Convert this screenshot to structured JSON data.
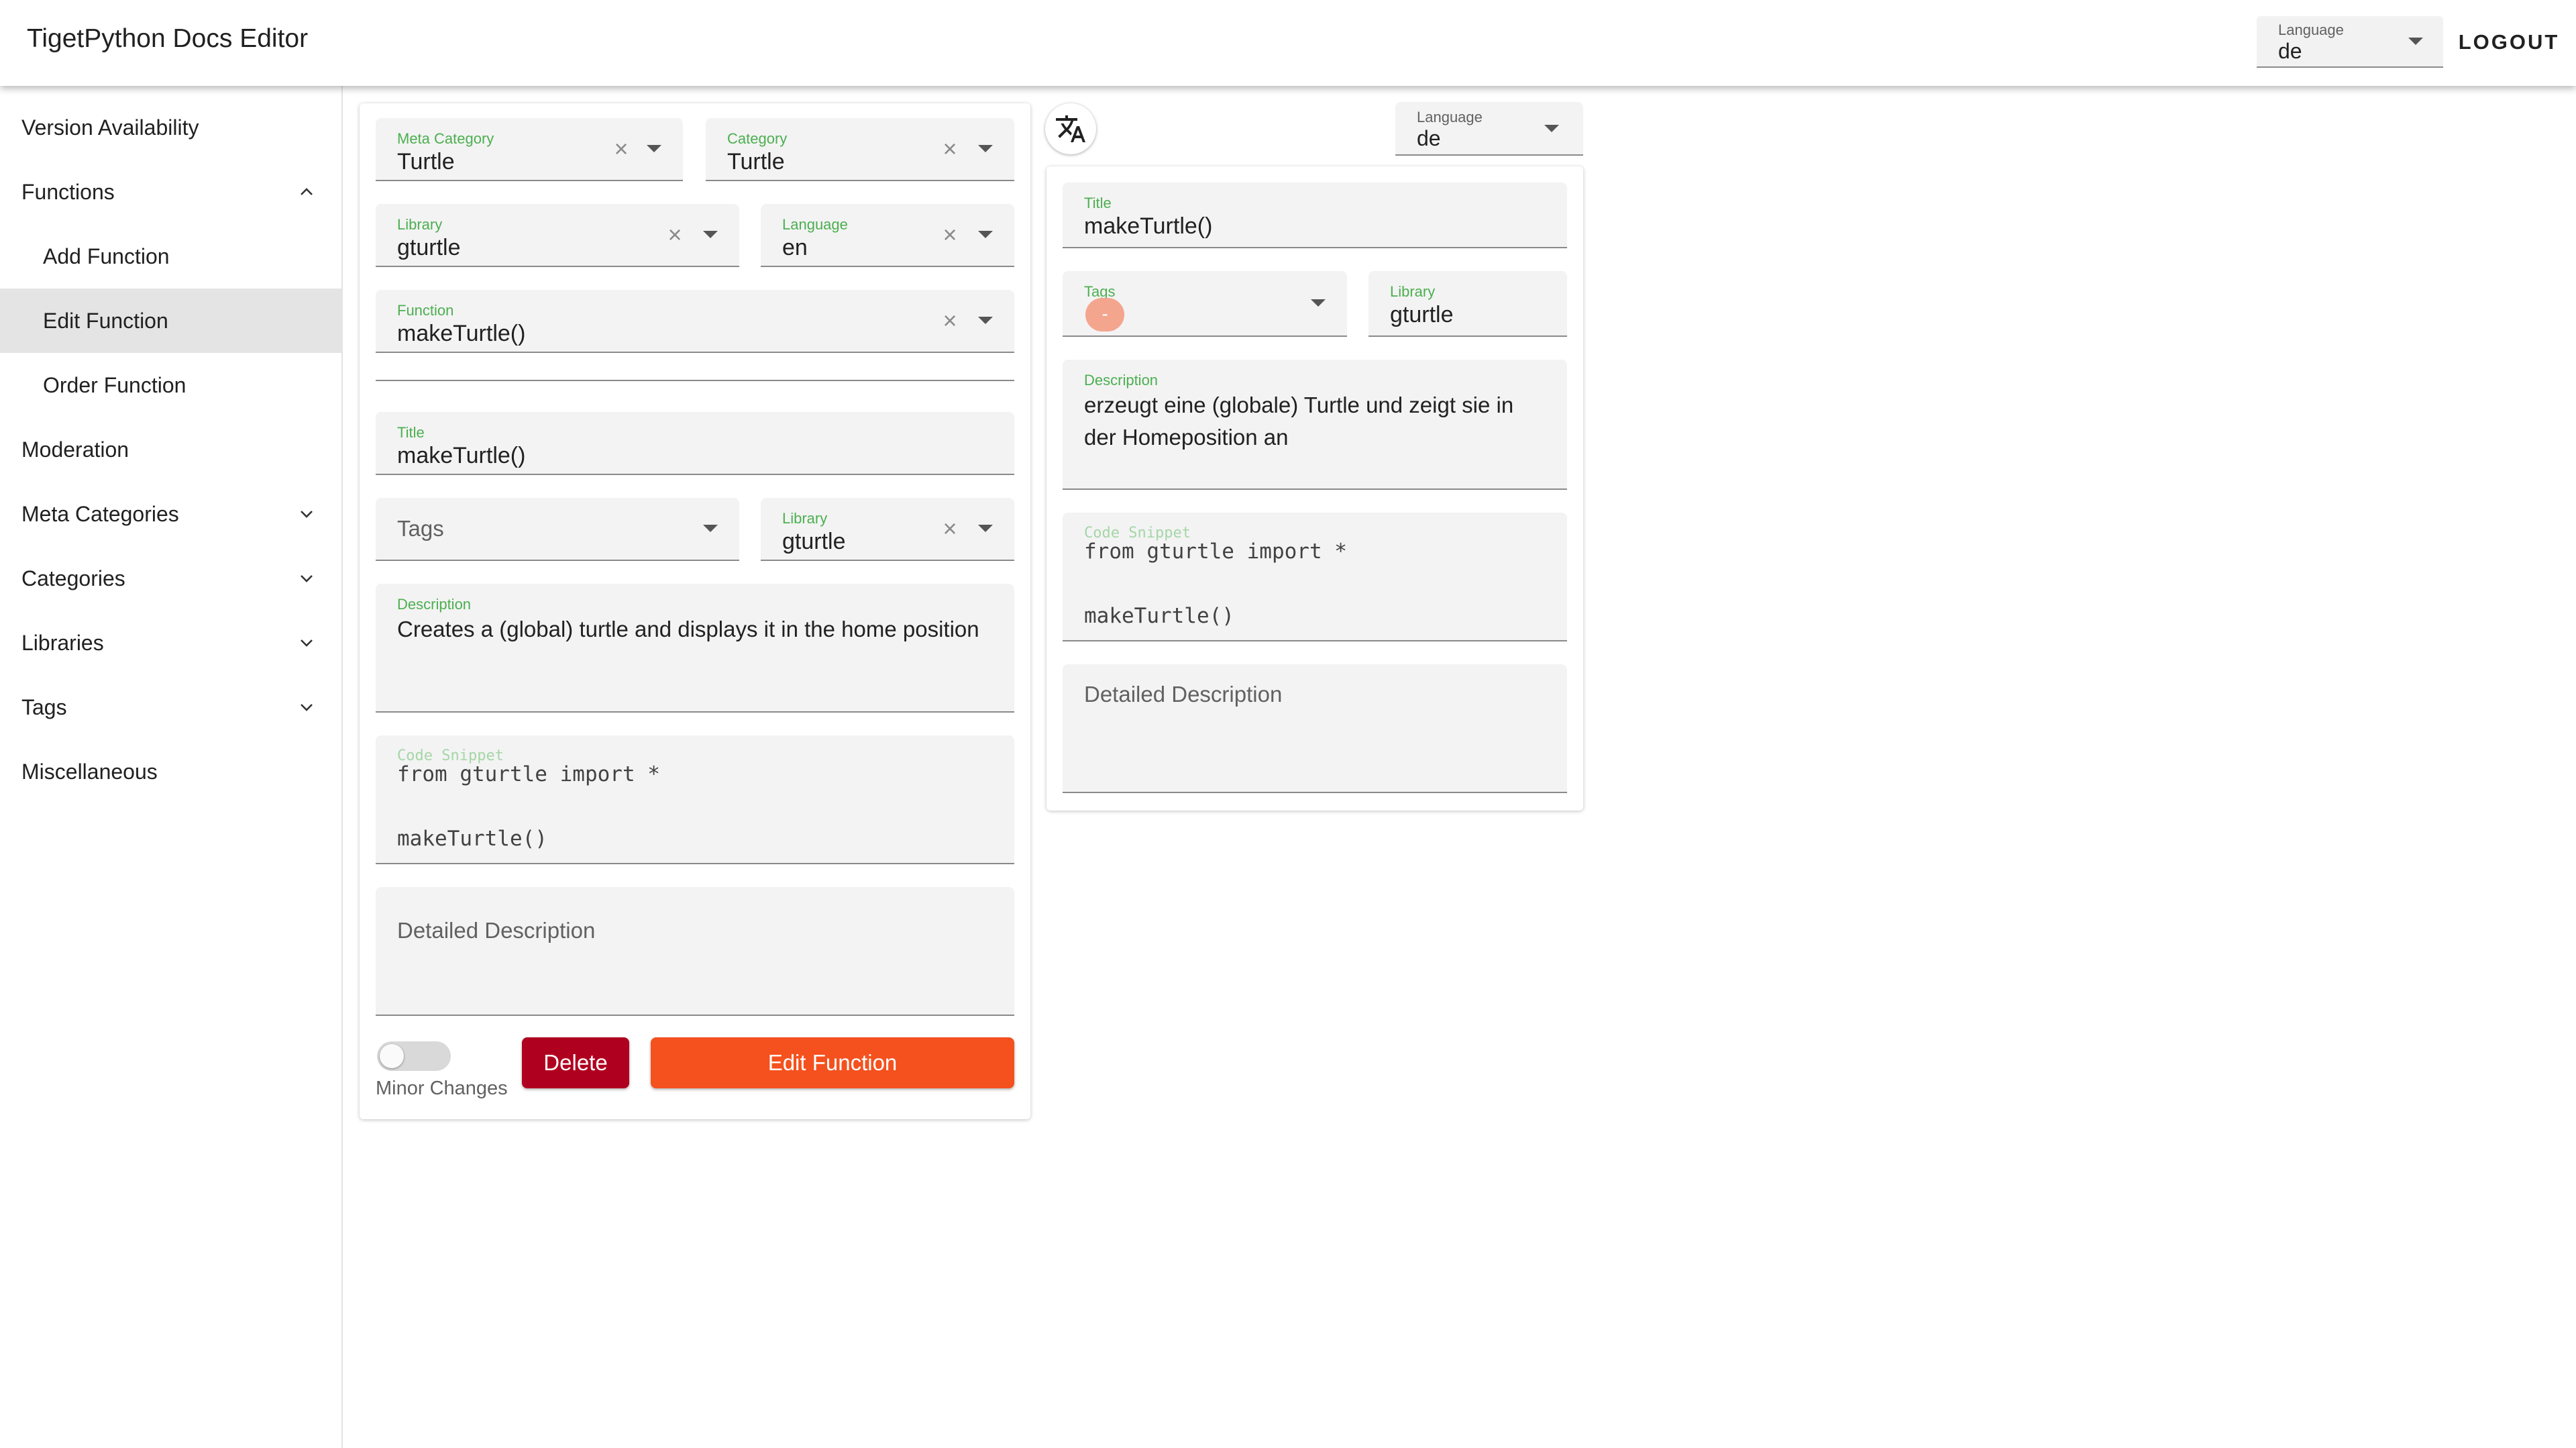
{
  "app": {
    "title": "TigetPython Docs Editor"
  },
  "header": {
    "language_label": "Language",
    "language_value": "de",
    "logout_label": "LOGOUT"
  },
  "sidebar": {
    "items": [
      {
        "label": "Version Availability"
      },
      {
        "label": "Functions",
        "expanded": true
      },
      {
        "label": "Add Function"
      },
      {
        "label": "Edit Function",
        "active": true
      },
      {
        "label": "Order Function"
      },
      {
        "label": "Moderation"
      },
      {
        "label": "Meta Categories"
      },
      {
        "label": "Categories"
      },
      {
        "label": "Libraries"
      },
      {
        "label": "Tags"
      },
      {
        "label": "Miscellaneous"
      }
    ]
  },
  "form": {
    "meta_category": {
      "label": "Meta Category",
      "value": "Turtle"
    },
    "category": {
      "label": "Category",
      "value": "Turtle"
    },
    "library_select": {
      "label": "Library",
      "value": "gturtle"
    },
    "language_select": {
      "label": "Language",
      "value": "en"
    },
    "function_select": {
      "label": "Function",
      "value": "makeTurtle()"
    },
    "title": {
      "label": "Title",
      "value": "makeTurtle()"
    },
    "tags": {
      "placeholder": "Tags"
    },
    "library": {
      "label": "Library",
      "value": "gturtle"
    },
    "description": {
      "label": "Description",
      "value": "Creates a (global) turtle and displays it in the home position"
    },
    "code_snippet": {
      "label": "Code Snippet",
      "line1": "from gturtle import *",
      "line2": "makeTurtle()"
    },
    "detailed_description": {
      "placeholder": "Detailed Description"
    },
    "minor_changes_label": "Minor Changes",
    "delete_label": "Delete",
    "submit_label": "Edit Function"
  },
  "translation": {
    "language": {
      "label": "Language",
      "value": "de"
    },
    "title": {
      "label": "Title",
      "value": "makeTurtle()"
    },
    "tags": {
      "label": "Tags",
      "chip": "-"
    },
    "library": {
      "label": "Library",
      "value": "gturtle"
    },
    "description": {
      "label": "Description",
      "value": "erzeugt eine (globale) Turtle und zeigt sie in der Homeposition an"
    },
    "code_snippet": {
      "label": "Code Snippet",
      "line1": "from gturtle import *",
      "line2": "makeTurtle()"
    },
    "detailed_description": {
      "placeholder": "Detailed Description"
    }
  },
  "colors": {
    "accent_green": "#4caf50",
    "delete": "#b00020",
    "submit": "#f4511e",
    "chip": "#f4a58e"
  },
  "icons": [
    "clear-icon",
    "dropdown-arrow-icon",
    "chevron-up-icon",
    "chevron-down-icon",
    "translate-icon"
  ]
}
